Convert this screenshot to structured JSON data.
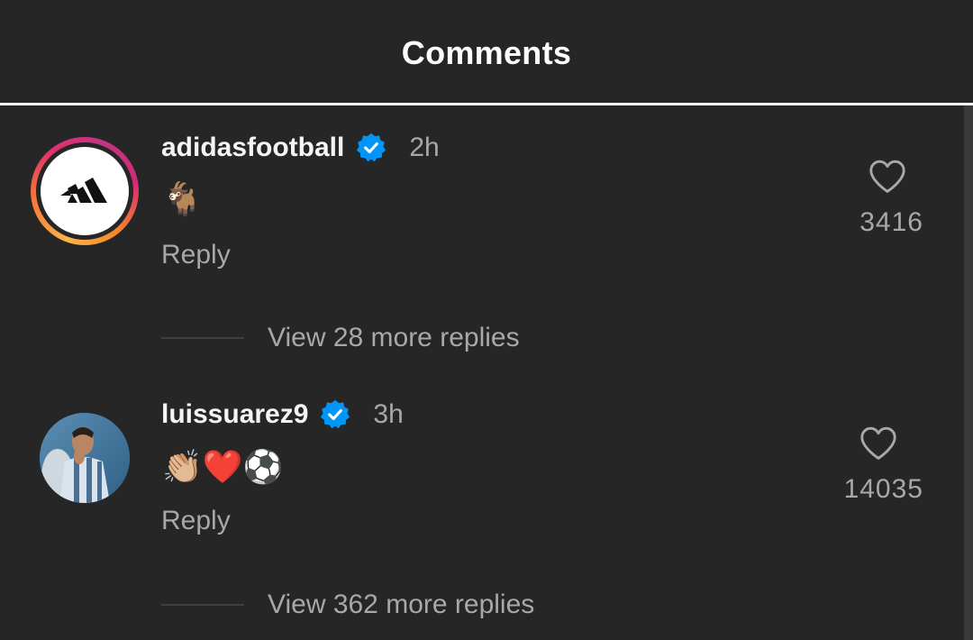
{
  "header": {
    "title": "Comments"
  },
  "colors": {
    "background": "#262626",
    "verified_badge": "#0095f6",
    "muted_text": "#a8a8a8",
    "primary_text": "#f5f5f5"
  },
  "comments": [
    {
      "username": "adidasfootball",
      "verified": true,
      "time": "2h",
      "text": "🐐",
      "reply_label": "Reply",
      "likes": "3416",
      "view_replies": "View 28 more replies",
      "avatar": "adidas-logo-icon",
      "has_story_ring": true
    },
    {
      "username": "luissuarez9",
      "verified": true,
      "time": "3h",
      "text": "👏🏼❤️⚽",
      "reply_label": "Reply",
      "likes": "14035",
      "view_replies": "View 362 more replies",
      "avatar": "profile-photo",
      "has_story_ring": false
    }
  ]
}
